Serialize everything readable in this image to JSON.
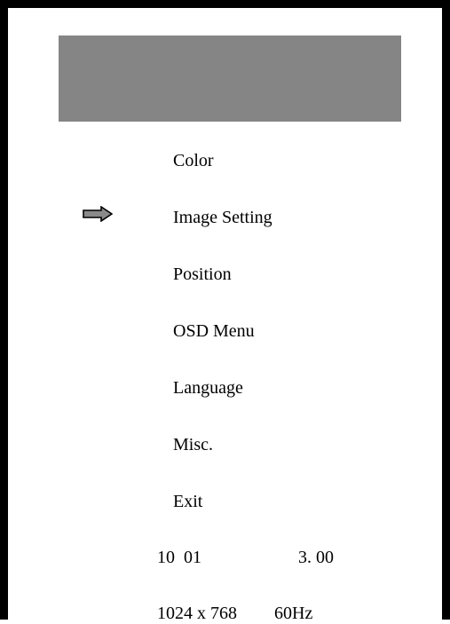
{
  "menu": {
    "items": [
      {
        "label": "Color"
      },
      {
        "label": "Image Setting"
      },
      {
        "label": "Position"
      },
      {
        "label": "OSD Menu"
      },
      {
        "label": "Language"
      },
      {
        "label": "Misc."
      },
      {
        "label": "Exit"
      }
    ],
    "selected_index": 1,
    "selector_icon": "right-arrow-icon"
  },
  "info": {
    "value_a": "10  01",
    "value_b": "3. 00",
    "resolution": "1024 x 768",
    "refresh_rate": "60Hz"
  },
  "colors": {
    "title_bar": "#858585",
    "frame": "#000000",
    "arrow_fill": "#8a8a8a"
  }
}
